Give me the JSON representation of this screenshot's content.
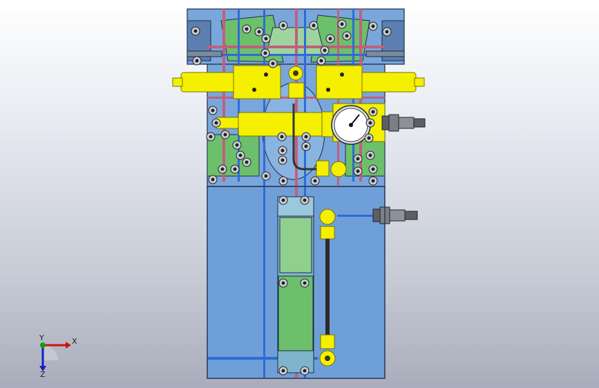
{
  "view": {
    "background_top": "#ffffff",
    "background_bottom": "#a9adbb",
    "colors": {
      "plate": "#6f9fd8",
      "plate_dark": "#5b8cc9",
      "plate_edge": "#1d2a44",
      "upper_block": "#79a6db",
      "green_part": "#6cc06c",
      "green_dark": "#3f8f3f",
      "yellow_part": "#f4f000",
      "yellow_edge": "#7a7000",
      "pink_channel": "#c0607c",
      "blue_channel": "#2f6bd6",
      "fitting_gray": "#5a6066",
      "gauge_face": "#ffffff"
    }
  },
  "triad": {
    "x_label": "X",
    "y_label": "Y",
    "z_label": "Z",
    "x_color": "#d01010",
    "y_color": "#10a010",
    "z_color": "#1020c0",
    "icon": "coordinate-triad-icon"
  }
}
